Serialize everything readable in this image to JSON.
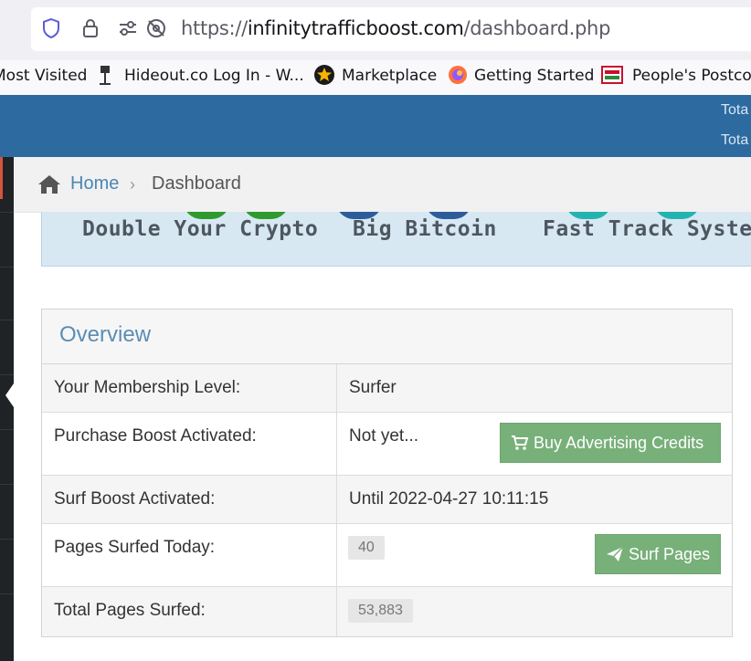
{
  "browser": {
    "url_prefix": "https://",
    "url_host": "infinitytrafficboost.com",
    "url_path": "/dashboard.php"
  },
  "bookmarks": [
    {
      "label": "Most Visited",
      "icon": "bookmark-icon"
    },
    {
      "label": "Hideout.co Log In - W...",
      "icon": "hideout-icon"
    },
    {
      "label": "Marketplace",
      "icon": "star-icon"
    },
    {
      "label": "Getting Started",
      "icon": "firefox-icon"
    },
    {
      "label": "People's Postcod",
      "icon": "postcode-icon"
    }
  ],
  "header": {
    "stats": [
      "Tota",
      "Tota"
    ],
    "color": "#2c6aa0"
  },
  "breadcrumb": {
    "home": "Home",
    "separator": "›",
    "current": "Dashboard"
  },
  "banner": {
    "items": [
      "Double Your Crypto",
      "Big Bitcoin",
      "Fast Track System"
    ]
  },
  "overview": {
    "title": "Overview",
    "membership_label": "Your Membership Level:",
    "membership_value": "Surfer",
    "purchase_label": "Purchase Boost Activated:",
    "purchase_value": "Not yet...",
    "buy_button": "Buy Advertising Credits",
    "surf_boost_label": "Surf Boost Activated:",
    "surf_boost_value": "Until 2022-04-27 10:11:15",
    "pages_today_label": "Pages Surfed Today:",
    "pages_today_value": "40",
    "surf_button": "Surf Pages",
    "total_label": "Total Pages Surfed:",
    "total_value": "53,883"
  },
  "colors": {
    "accent": "#5a8db5",
    "button": "#78b07a",
    "sidebar": "#1f2326"
  }
}
